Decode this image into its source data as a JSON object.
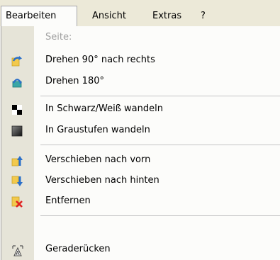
{
  "menubar": {
    "items": [
      "Bearbeiten",
      "Ansicht",
      "Extras",
      "?"
    ]
  },
  "dropdown": {
    "header": "Seite:",
    "items": [
      {
        "label": "Drehen 90° nach rechts",
        "icon": "rotate-right-icon"
      },
      {
        "label": "Drehen 180°",
        "icon": "rotate-180-icon"
      },
      {
        "label": "In Schwarz/Weiß wandeln",
        "icon": "black-white-icon"
      },
      {
        "label": "In Graustufen wandeln",
        "icon": "grayscale-icon"
      },
      {
        "label": "Verschieben nach vorn",
        "icon": "move-forward-icon"
      },
      {
        "label": "Verschieben nach hinten",
        "icon": "move-back-icon"
      },
      {
        "label": "Entfernen",
        "icon": "remove-icon"
      },
      {
        "label": "Geraderücken",
        "icon": "straighten-icon"
      }
    ]
  }
}
